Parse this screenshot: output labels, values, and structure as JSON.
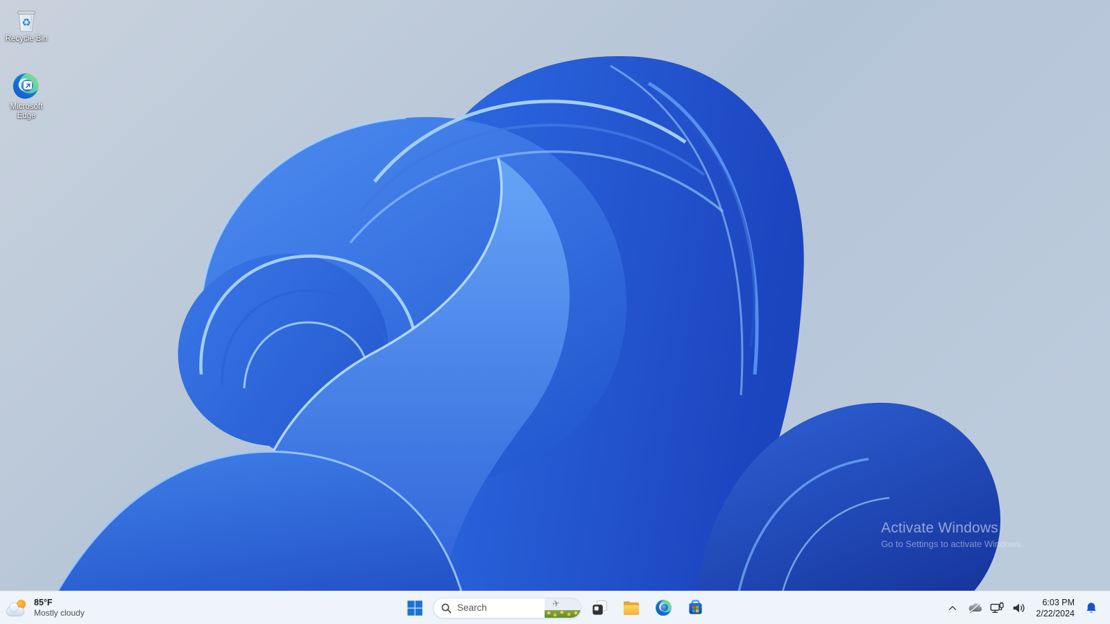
{
  "desktop": {
    "icons": [
      {
        "label": "Recycle Bin",
        "icon": "recycle-bin-icon"
      },
      {
        "label": "Microsoft Edge",
        "icon": "edge-icon"
      }
    ],
    "watermark": {
      "line1": "Activate Windows",
      "line2": "Go to Settings to activate Windows."
    }
  },
  "taskbar": {
    "weather": {
      "temperature": "85°F",
      "condition": "Mostly cloudy",
      "icon": "sun-behind-cloud-icon"
    },
    "start": {
      "icon": "windows-logo-icon"
    },
    "search": {
      "placeholder": "Search",
      "icon": "search-icon",
      "thumbnail": "plane-over-flower-field"
    },
    "apps": [
      {
        "name": "task-view",
        "icon": "task-view-icon"
      },
      {
        "name": "file-explorer",
        "icon": "file-explorer-icon"
      },
      {
        "name": "microsoft-edge",
        "icon": "edge-icon"
      },
      {
        "name": "microsoft-store",
        "icon": "microsoft-store-icon"
      }
    ],
    "tray": {
      "chevron": "chevron-up-icon",
      "status_icons": [
        "onedrive-offline-icon",
        "ethernet-network-icon",
        "volume-icon"
      ],
      "time": "6:03 PM",
      "date": "2/22/2024",
      "bell": "notification-bell-icon"
    }
  },
  "colors": {
    "taskbar_bg": "#eff3fa",
    "start_blue": "#1b72d4",
    "bell_blue": "#1656cb",
    "bloom_blue": "#2a63e0",
    "wallpaper_bg": "#b9c8da"
  }
}
